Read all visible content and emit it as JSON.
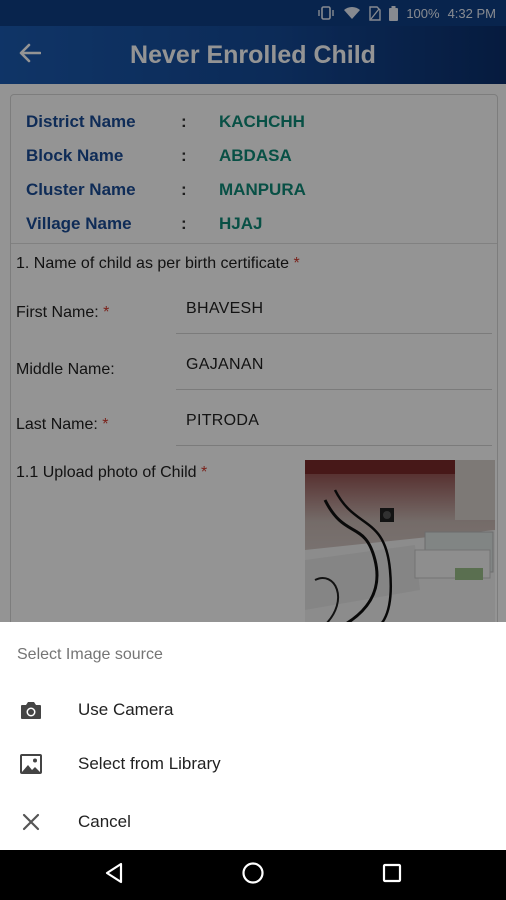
{
  "status_bar": {
    "battery": "100%",
    "time": "4:32 PM",
    "icons": [
      "vibrate-icon",
      "wifi-icon",
      "no-sim-icon",
      "battery-icon"
    ]
  },
  "app_bar": {
    "title": "Never Enrolled Child",
    "back_icon": "arrow-left-icon"
  },
  "location": [
    {
      "label": "District Name",
      "colon": ":",
      "value": "KACHCHH"
    },
    {
      "label": "Block Name",
      "colon": ":",
      "value": "ABDASA"
    },
    {
      "label": "Cluster Name",
      "colon": ":",
      "value": "MANPURA"
    },
    {
      "label": "Village Name",
      "colon": ":",
      "value": "HJAJ"
    }
  ],
  "form": {
    "q1_label": "1. Name of child as per birth certificate",
    "required_mark": "*",
    "first_name_label": "First Name:",
    "first_name_value": "BHAVESH",
    "middle_name_label": "Middle Name:",
    "middle_name_value": "GAJANAN",
    "last_name_label": "Last Name:",
    "last_name_value": "PITRODA",
    "upload_label": "1.1 Upload photo of Child"
  },
  "sheet": {
    "title": "Select Image source",
    "items": [
      {
        "label": "Use Camera",
        "icon": "camera-icon"
      },
      {
        "label": "Select from Library",
        "icon": "image-icon"
      },
      {
        "label": "Cancel",
        "icon": "close-icon"
      }
    ]
  },
  "nav_bar": {
    "icons": [
      "back-triangle-icon",
      "home-circle-icon",
      "recents-square-icon"
    ]
  },
  "colors": {
    "app_bar": "#154a97",
    "label_blue": "#1b4c96",
    "value_teal": "#0f8a78",
    "required_red": "#d23a2e"
  }
}
